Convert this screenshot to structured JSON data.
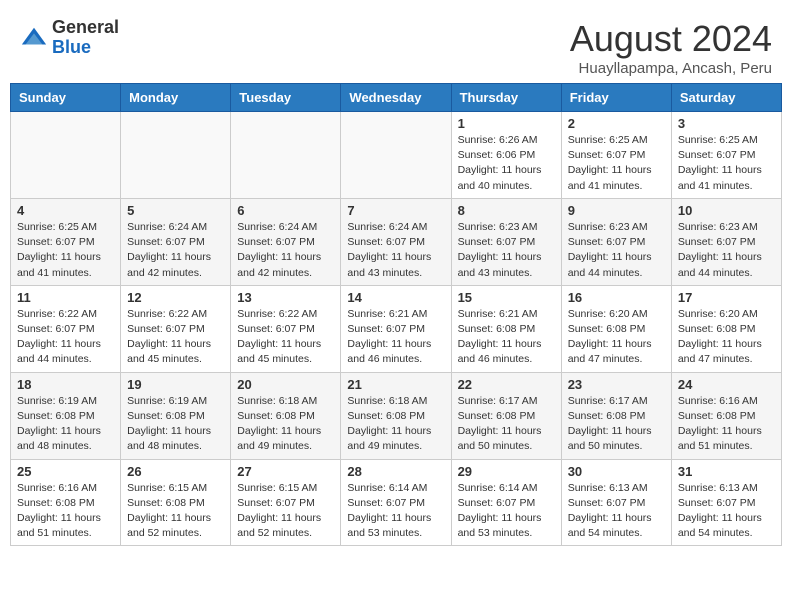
{
  "header": {
    "logo_general": "General",
    "logo_blue": "Blue",
    "month_year": "August 2024",
    "location": "Huayllapampa, Ancash, Peru"
  },
  "weekdays": [
    "Sunday",
    "Monday",
    "Tuesday",
    "Wednesday",
    "Thursday",
    "Friday",
    "Saturday"
  ],
  "weeks": [
    [
      {
        "day": "",
        "sunrise": "",
        "sunset": "",
        "daylight": ""
      },
      {
        "day": "",
        "sunrise": "",
        "sunset": "",
        "daylight": ""
      },
      {
        "day": "",
        "sunrise": "",
        "sunset": "",
        "daylight": ""
      },
      {
        "day": "",
        "sunrise": "",
        "sunset": "",
        "daylight": ""
      },
      {
        "day": "1",
        "sunrise": "Sunrise: 6:26 AM",
        "sunset": "Sunset: 6:06 PM",
        "daylight": "Daylight: 11 hours and 40 minutes."
      },
      {
        "day": "2",
        "sunrise": "Sunrise: 6:25 AM",
        "sunset": "Sunset: 6:07 PM",
        "daylight": "Daylight: 11 hours and 41 minutes."
      },
      {
        "day": "3",
        "sunrise": "Sunrise: 6:25 AM",
        "sunset": "Sunset: 6:07 PM",
        "daylight": "Daylight: 11 hours and 41 minutes."
      }
    ],
    [
      {
        "day": "4",
        "sunrise": "Sunrise: 6:25 AM",
        "sunset": "Sunset: 6:07 PM",
        "daylight": "Daylight: 11 hours and 41 minutes."
      },
      {
        "day": "5",
        "sunrise": "Sunrise: 6:24 AM",
        "sunset": "Sunset: 6:07 PM",
        "daylight": "Daylight: 11 hours and 42 minutes."
      },
      {
        "day": "6",
        "sunrise": "Sunrise: 6:24 AM",
        "sunset": "Sunset: 6:07 PM",
        "daylight": "Daylight: 11 hours and 42 minutes."
      },
      {
        "day": "7",
        "sunrise": "Sunrise: 6:24 AM",
        "sunset": "Sunset: 6:07 PM",
        "daylight": "Daylight: 11 hours and 43 minutes."
      },
      {
        "day": "8",
        "sunrise": "Sunrise: 6:23 AM",
        "sunset": "Sunset: 6:07 PM",
        "daylight": "Daylight: 11 hours and 43 minutes."
      },
      {
        "day": "9",
        "sunrise": "Sunrise: 6:23 AM",
        "sunset": "Sunset: 6:07 PM",
        "daylight": "Daylight: 11 hours and 44 minutes."
      },
      {
        "day": "10",
        "sunrise": "Sunrise: 6:23 AM",
        "sunset": "Sunset: 6:07 PM",
        "daylight": "Daylight: 11 hours and 44 minutes."
      }
    ],
    [
      {
        "day": "11",
        "sunrise": "Sunrise: 6:22 AM",
        "sunset": "Sunset: 6:07 PM",
        "daylight": "Daylight: 11 hours and 44 minutes."
      },
      {
        "day": "12",
        "sunrise": "Sunrise: 6:22 AM",
        "sunset": "Sunset: 6:07 PM",
        "daylight": "Daylight: 11 hours and 45 minutes."
      },
      {
        "day": "13",
        "sunrise": "Sunrise: 6:22 AM",
        "sunset": "Sunset: 6:07 PM",
        "daylight": "Daylight: 11 hours and 45 minutes."
      },
      {
        "day": "14",
        "sunrise": "Sunrise: 6:21 AM",
        "sunset": "Sunset: 6:07 PM",
        "daylight": "Daylight: 11 hours and 46 minutes."
      },
      {
        "day": "15",
        "sunrise": "Sunrise: 6:21 AM",
        "sunset": "Sunset: 6:08 PM",
        "daylight": "Daylight: 11 hours and 46 minutes."
      },
      {
        "day": "16",
        "sunrise": "Sunrise: 6:20 AM",
        "sunset": "Sunset: 6:08 PM",
        "daylight": "Daylight: 11 hours and 47 minutes."
      },
      {
        "day": "17",
        "sunrise": "Sunrise: 6:20 AM",
        "sunset": "Sunset: 6:08 PM",
        "daylight": "Daylight: 11 hours and 47 minutes."
      }
    ],
    [
      {
        "day": "18",
        "sunrise": "Sunrise: 6:19 AM",
        "sunset": "Sunset: 6:08 PM",
        "daylight": "Daylight: 11 hours and 48 minutes."
      },
      {
        "day": "19",
        "sunrise": "Sunrise: 6:19 AM",
        "sunset": "Sunset: 6:08 PM",
        "daylight": "Daylight: 11 hours and 48 minutes."
      },
      {
        "day": "20",
        "sunrise": "Sunrise: 6:18 AM",
        "sunset": "Sunset: 6:08 PM",
        "daylight": "Daylight: 11 hours and 49 minutes."
      },
      {
        "day": "21",
        "sunrise": "Sunrise: 6:18 AM",
        "sunset": "Sunset: 6:08 PM",
        "daylight": "Daylight: 11 hours and 49 minutes."
      },
      {
        "day": "22",
        "sunrise": "Sunrise: 6:17 AM",
        "sunset": "Sunset: 6:08 PM",
        "daylight": "Daylight: 11 hours and 50 minutes."
      },
      {
        "day": "23",
        "sunrise": "Sunrise: 6:17 AM",
        "sunset": "Sunset: 6:08 PM",
        "daylight": "Daylight: 11 hours and 50 minutes."
      },
      {
        "day": "24",
        "sunrise": "Sunrise: 6:16 AM",
        "sunset": "Sunset: 6:08 PM",
        "daylight": "Daylight: 11 hours and 51 minutes."
      }
    ],
    [
      {
        "day": "25",
        "sunrise": "Sunrise: 6:16 AM",
        "sunset": "Sunset: 6:08 PM",
        "daylight": "Daylight: 11 hours and 51 minutes."
      },
      {
        "day": "26",
        "sunrise": "Sunrise: 6:15 AM",
        "sunset": "Sunset: 6:08 PM",
        "daylight": "Daylight: 11 hours and 52 minutes."
      },
      {
        "day": "27",
        "sunrise": "Sunrise: 6:15 AM",
        "sunset": "Sunset: 6:07 PM",
        "daylight": "Daylight: 11 hours and 52 minutes."
      },
      {
        "day": "28",
        "sunrise": "Sunrise: 6:14 AM",
        "sunset": "Sunset: 6:07 PM",
        "daylight": "Daylight: 11 hours and 53 minutes."
      },
      {
        "day": "29",
        "sunrise": "Sunrise: 6:14 AM",
        "sunset": "Sunset: 6:07 PM",
        "daylight": "Daylight: 11 hours and 53 minutes."
      },
      {
        "day": "30",
        "sunrise": "Sunrise: 6:13 AM",
        "sunset": "Sunset: 6:07 PM",
        "daylight": "Daylight: 11 hours and 54 minutes."
      },
      {
        "day": "31",
        "sunrise": "Sunrise: 6:13 AM",
        "sunset": "Sunset: 6:07 PM",
        "daylight": "Daylight: 11 hours and 54 minutes."
      }
    ]
  ]
}
